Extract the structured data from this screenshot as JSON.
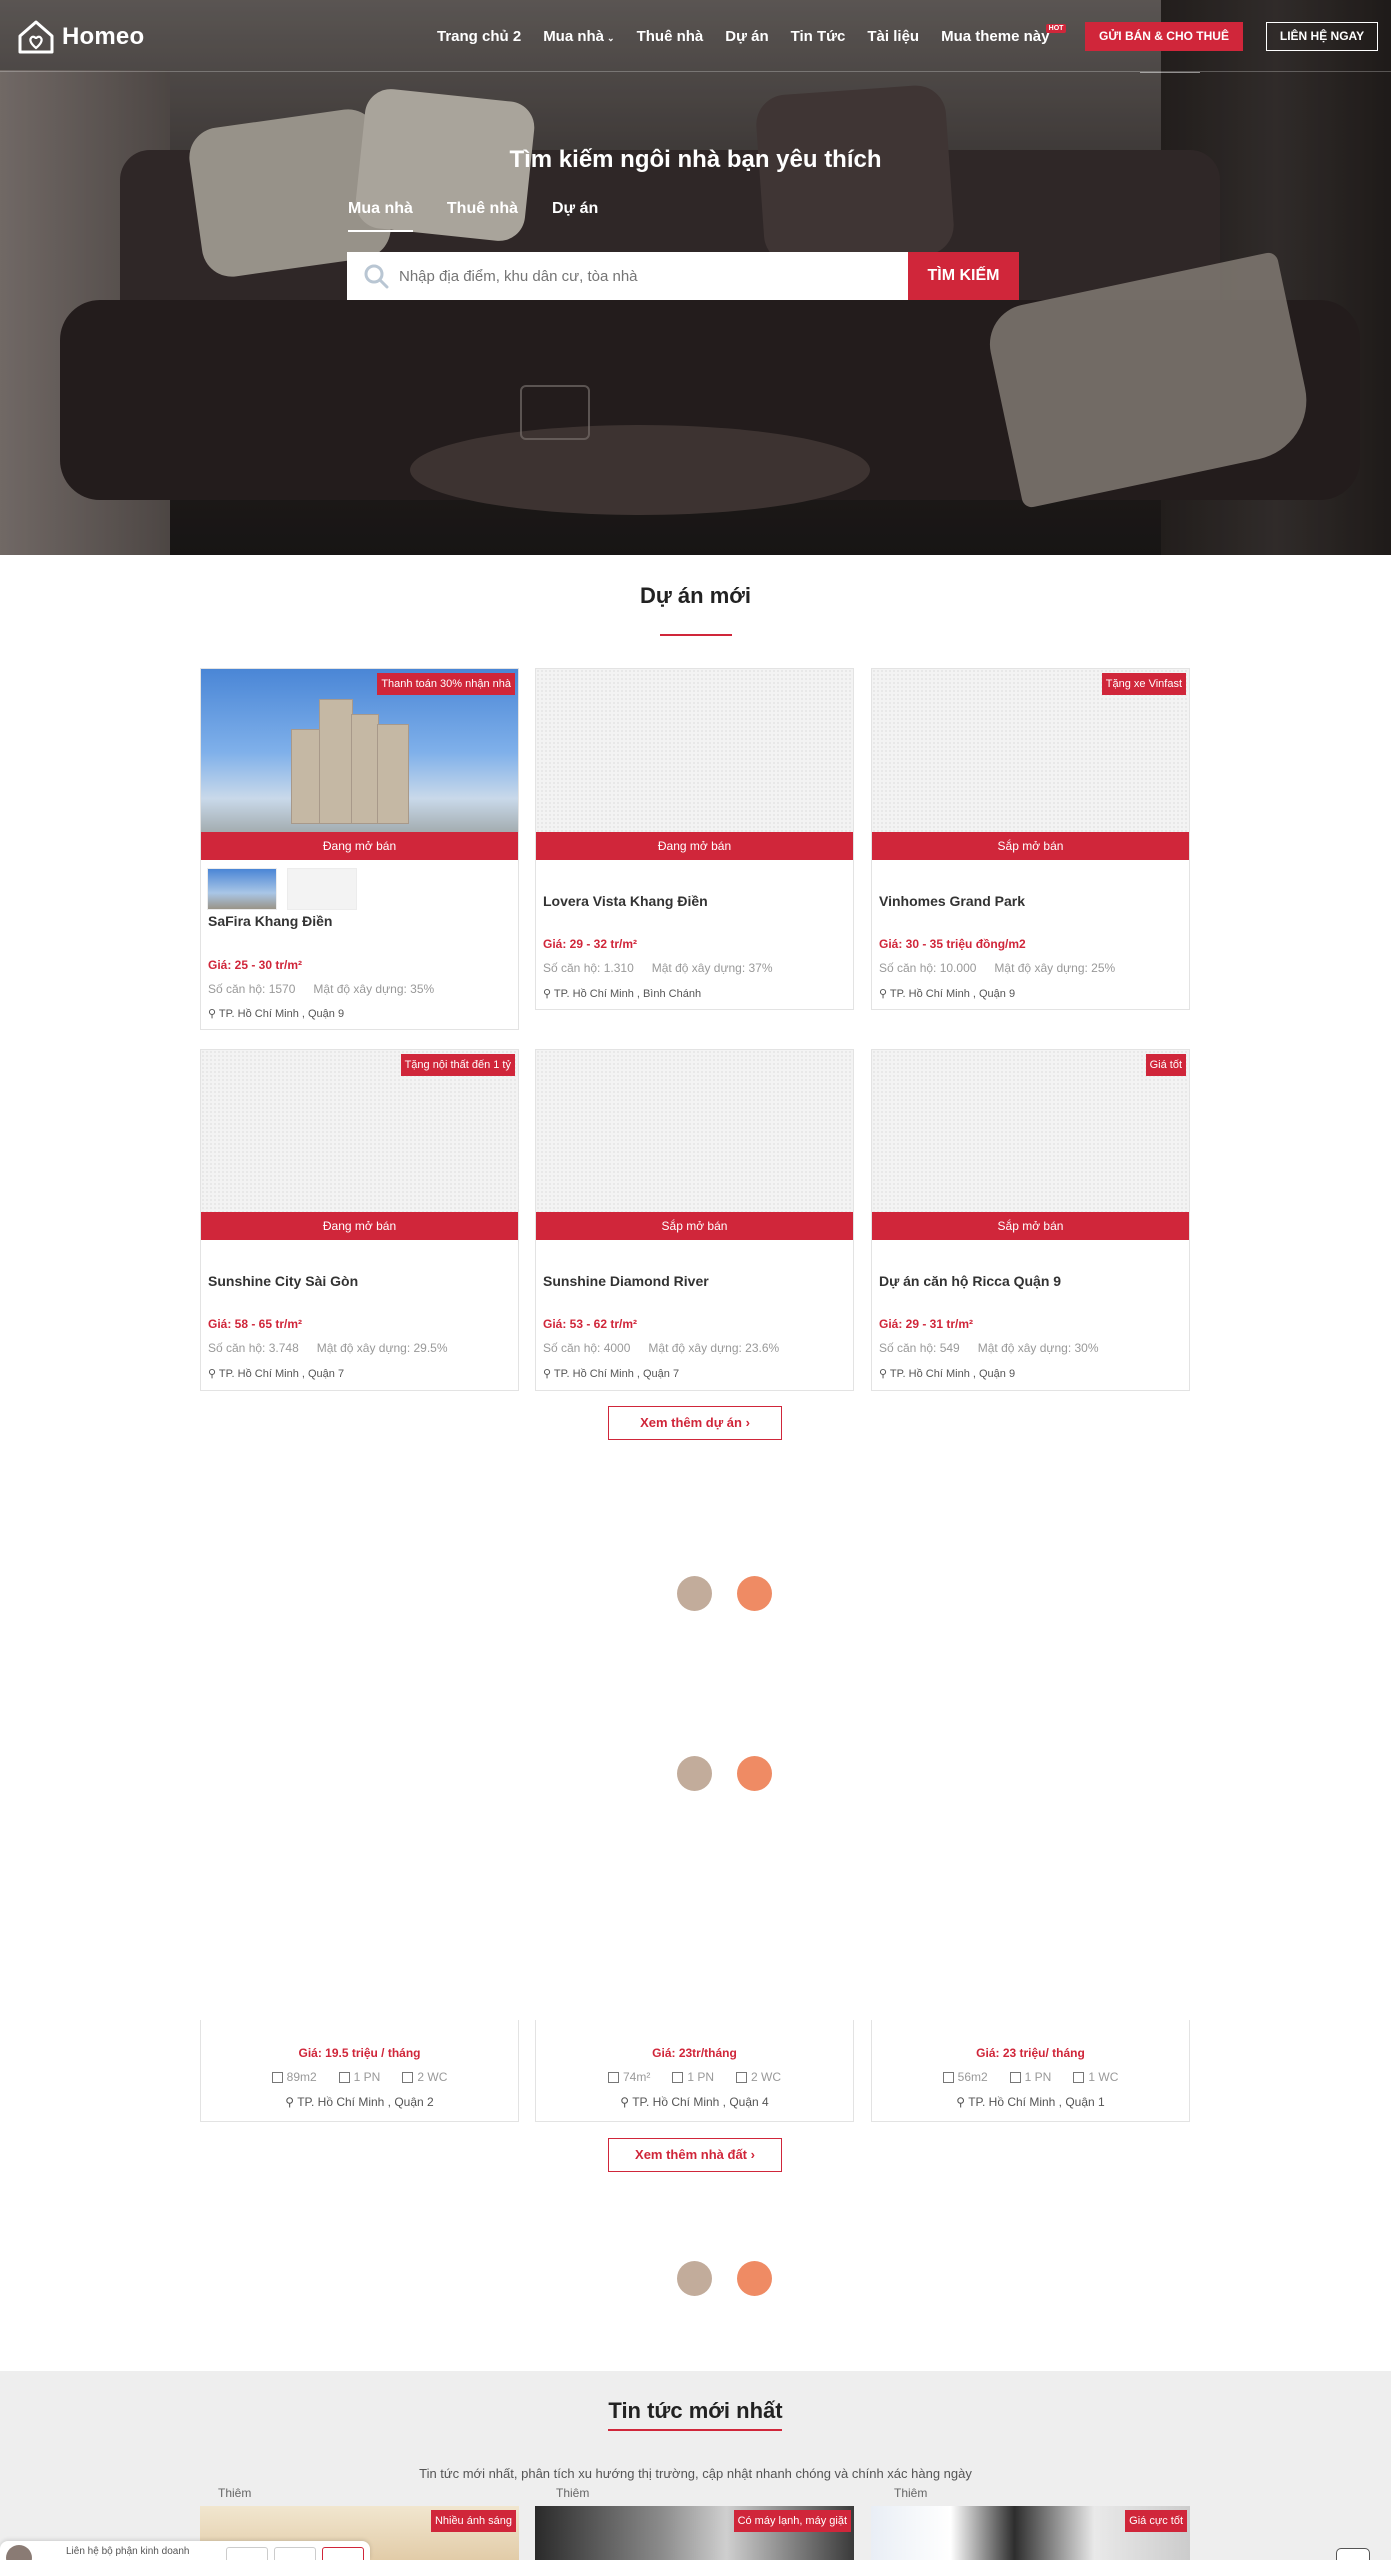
{
  "header": {
    "logo_text": "Homeo",
    "nav": [
      {
        "label": "Trang chủ 2"
      },
      {
        "label": "Mua nhà",
        "has_dropdown": true
      },
      {
        "label": "Thuê nhà"
      },
      {
        "label": "Dự án"
      },
      {
        "label": "Tin Tức"
      },
      {
        "label": "Tài liệu"
      },
      {
        "label": "Mua theme này",
        "badge": "HOT"
      }
    ],
    "sell_button": "GỬI BÁN & CHO THUÊ",
    "contact_button": "LIÊN HỆ NGAY"
  },
  "hero": {
    "title": "Tìm kiếm ngôi nhà bạn yêu thích",
    "tabs": [
      "Mua nhà",
      "Thuê nhà",
      "Dự án"
    ],
    "active_tab": "Mua nhà",
    "search_placeholder": "Nhập địa điểm, khu dân cư, tòa nhà",
    "search_button": "TÌM KIẾM"
  },
  "projects": {
    "title": "Dự án mới",
    "items": [
      {
        "name": "SaFira Khang Điền",
        "badge": "Thanh toán 30% nhận nhà",
        "status": "Đang mở bán",
        "price": "Giá: 25 - 30 tr/m²",
        "units": "Số căn hộ: 1570",
        "density": "Mật độ xây dựng: 35%",
        "location": "TP. Hồ Chí Minh , Quận 9"
      },
      {
        "name": "Lovera Vista Khang Điền",
        "badge": "",
        "status": "Đang mở bán",
        "price": "Giá: 29 - 32 tr/m²",
        "units": "Số căn hộ: 1.310",
        "density": "Mật độ xây dựng: 37%",
        "location": "TP. Hồ Chí Minh , Bình Chánh"
      },
      {
        "name": "Vinhomes Grand Park",
        "badge": "Tặng xe Vinfast",
        "status": "Sắp mở bán",
        "price": "Giá: 30 - 35 triệu đồng/m2",
        "units": "Số căn hộ: 10.000",
        "density": "Mật độ xây dựng: 25%",
        "location": "TP. Hồ Chí Minh , Quận 9"
      },
      {
        "name": "Sunshine City Sài Gòn",
        "badge": "Tặng nội thất đến 1 tỷ",
        "status": "Đang mở bán",
        "price": "Giá: 58 - 65 tr/m²",
        "units": "Số căn hộ: 3.748",
        "density": "Mật độ xây dựng: 29.5%",
        "location": "TP. Hồ Chí Minh , Quận 7"
      },
      {
        "name": "Sunshine Diamond River",
        "badge": "",
        "status": "Sắp mở bán",
        "price": "Giá: 53 - 62 tr/m²",
        "units": "Số căn hộ: 4000",
        "density": "Mật độ xây dựng: 23.6%",
        "location": "TP. Hồ Chí Minh , Quận 7"
      },
      {
        "name": "Dự án căn hộ Ricca Quận 9",
        "badge": "Giá tốt",
        "status": "Sắp mở bán",
        "price": "Giá: 29 - 31 tr/m²",
        "units": "Số căn hộ: 549",
        "density": "Mật độ xây dựng: 30%",
        "location": "TP. Hồ Chí Minh , Quận 9"
      }
    ],
    "more_button": "Xem thêm dự án"
  },
  "rentals": {
    "items": [
      {
        "price": "Giá: 19.5 triệu / tháng",
        "area": "89m2",
        "bedrooms": "1 PN",
        "baths": "2 WC",
        "location": "TP. Hồ Chí Minh , Quận 2"
      },
      {
        "price": "Giá: 23tr/tháng",
        "area": "74m²",
        "bedrooms": "1 PN",
        "baths": "2 WC",
        "location": "TP. Hồ Chí Minh , Quận 4"
      },
      {
        "price": "Giá: 23 triệu/ tháng",
        "area": "56m2",
        "bedrooms": "1 PN",
        "baths": "1 WC",
        "location": "TP. Hồ Chí Minh , Quận 1"
      }
    ],
    "more_button": "Xem thêm nhà đất"
  },
  "news": {
    "title": "Tin tức mới nhất",
    "subtitle": "Tin tức mới nhất, phân tích xu hướng thị trường, cập nhật nhanh chóng và chính xác hàng ngày",
    "items": [
      {
        "category": "Thiêm",
        "badge": "Nhiều ánh sáng"
      },
      {
        "category": "Thiêm",
        "badge": "Có máy lạnh, máy giặt"
      },
      {
        "category": "Thiêm",
        "badge": "Giá cực tốt"
      }
    ]
  },
  "chat": {
    "text": "Liên hệ bộ phận kinh doanh"
  },
  "colors": {
    "accent": "#d0263a",
    "loader_a": "#c2ac9b",
    "loader_b": "#ef8b64"
  }
}
